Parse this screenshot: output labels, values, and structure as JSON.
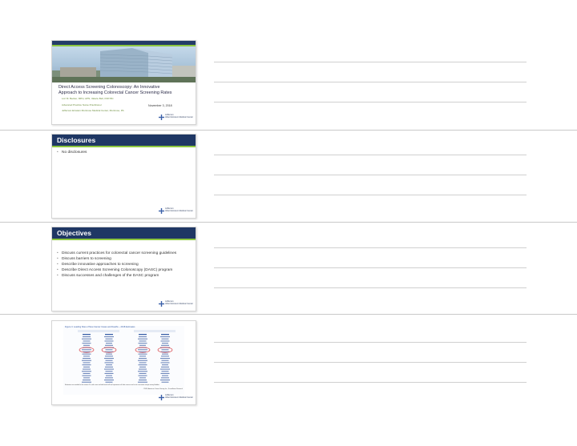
{
  "slides": [
    {
      "title_line1": "Direct Access Screening Colonoscopy: An Innovative",
      "title_line2": "Approach to Increasing Colorectal Cancer Screening Rates",
      "author": "Lori M. Becker, MPH, APN; Valerie Bell, FNP-BC",
      "role": "Advanced Practice Nurse Practitioner",
      "institution": "Jefferson Einstein Montrose Medical Center, Montrose, PA",
      "date": "November 3, 2018",
      "logo_name": "Jefferson",
      "logo_sub": "Albert Einstein Medical Center"
    },
    {
      "heading": "Disclosures",
      "bullets": [
        "No disclosures"
      ],
      "logo_name": "Jefferson",
      "logo_sub": "Albert Einstein Medical Center"
    },
    {
      "heading": "Objectives",
      "bullets": [
        "Discuss current practices for colorectal cancer screening guidelines",
        "Discuss barriers to screening",
        "Describe innovative approaches to screening",
        "Describe Direct Access Screening Colonoscopy (DASC) program",
        "Discuss successes and challenges of the DASC program"
      ],
      "logo_name": "Jefferson",
      "logo_sub": "Albert Einstein Medical Center"
    },
    {
      "figure_title": "Figure 3. Leading Sites of New Cancer Cases and Deaths – 2018 Estimates",
      "footnote": "Estimates are rounded to the nearest 10, and cases exclude basal cell and squamous cell skin cancers and in situ carcinoma except urinary bladder.",
      "source": "©2018, American Cancer Society, Inc., Surveillance Research",
      "logo_name": "Jefferson",
      "logo_sub": "Albert Einstein Medical Center"
    }
  ],
  "colors": {
    "navy": "#1f3764",
    "green": "#8dc63f",
    "highlight": "#d2232a"
  }
}
